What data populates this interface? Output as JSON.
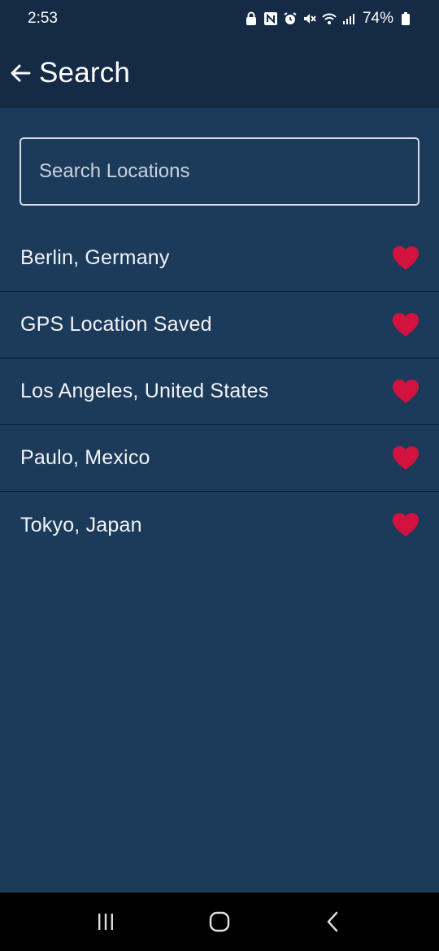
{
  "status_bar": {
    "time": "2:53",
    "battery": "74%",
    "icons": [
      "lock-icon",
      "nfc-icon",
      "alarm-icon",
      "mute-icon",
      "wifi-icon",
      "signal-icon",
      "battery-icon"
    ]
  },
  "app_bar": {
    "title": "Search",
    "back_icon": "arrow-left-icon"
  },
  "search": {
    "placeholder": "Search Locations",
    "value": ""
  },
  "locations": [
    {
      "label": "Berlin, Germany",
      "favorite": true
    },
    {
      "label": "GPS Location Saved",
      "favorite": true
    },
    {
      "label": "Los Angeles, United States",
      "favorite": true
    },
    {
      "label": "Paulo, Mexico",
      "favorite": true
    },
    {
      "label": "Tokyo, Japan",
      "favorite": true
    }
  ],
  "colors": {
    "header_bg": "#142a45",
    "content_bg": "#1c3a5a",
    "heart": "#d4123f",
    "divider": "#0d1a29"
  },
  "nav_bar": {
    "buttons": [
      "recent-apps-icon",
      "home-icon",
      "back-icon"
    ]
  }
}
